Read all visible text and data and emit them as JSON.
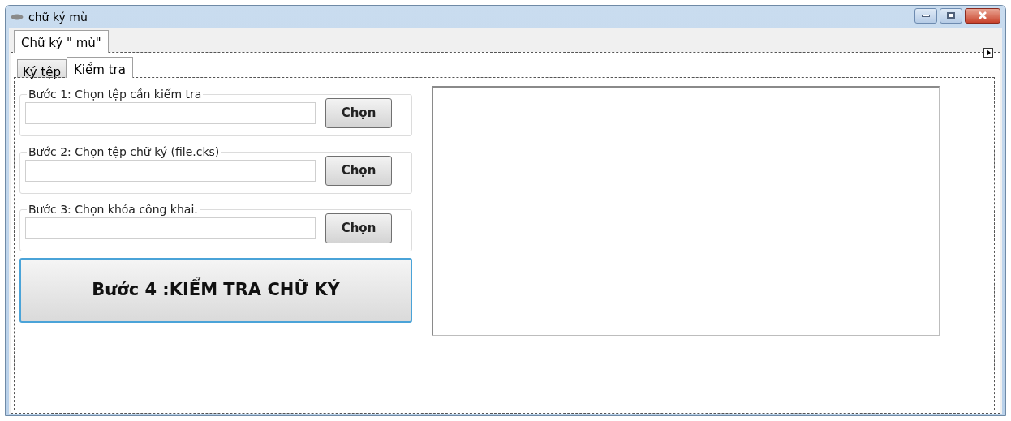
{
  "window": {
    "title": "chữ ký mù"
  },
  "outer_tabs": [
    {
      "label": "Chữ ký \" mù\"",
      "selected": true
    }
  ],
  "inner_tabs": [
    {
      "label": "Ký tệp",
      "selected": false
    },
    {
      "label": "Kiểm tra",
      "selected": true
    }
  ],
  "steps": [
    {
      "legend": "Bước 1: Chọn tệp cần kiểm tra",
      "button": "Chọn"
    },
    {
      "legend": "Bước 2: Chọn tệp chữ ký (file.cks)",
      "button": "Chọn"
    },
    {
      "legend": "Bước 3: Chọn khóa công khai.",
      "button": "Chọn"
    }
  ],
  "verify_button": "Bước 4 :KIỂM TRA CHỮ KÝ"
}
